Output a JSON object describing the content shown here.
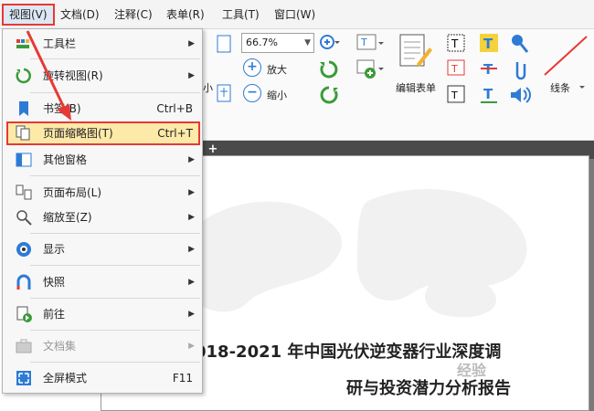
{
  "menubar": {
    "items": [
      {
        "label": "视图(V)",
        "active": true
      },
      {
        "label": "文档(D)"
      },
      {
        "label": "注释(C)"
      },
      {
        "label": "表单(R)"
      },
      {
        "label": "工具(T)"
      },
      {
        "label": "窗口(W)"
      }
    ]
  },
  "view_menu": {
    "items": [
      {
        "label": "工具栏",
        "shortcut": "",
        "submenu": true
      },
      {
        "label": "旋转视图(R)",
        "shortcut": "",
        "submenu": true
      },
      {
        "label": "书签(B)",
        "shortcut": "Ctrl+B",
        "submenu": false
      },
      {
        "label": "页面缩略图(T)",
        "shortcut": "Ctrl+T",
        "submenu": false,
        "highlighted": true
      },
      {
        "label": "其他窗格",
        "shortcut": "",
        "submenu": true
      },
      {
        "label": "页面布局(L)",
        "shortcut": "",
        "submenu": true
      },
      {
        "label": "缩放至(Z)",
        "shortcut": "",
        "submenu": true
      },
      {
        "label": "显示",
        "shortcut": "",
        "submenu": true
      },
      {
        "label": "快照",
        "shortcut": "",
        "submenu": true
      },
      {
        "label": "前往",
        "shortcut": "",
        "submenu": true
      },
      {
        "label": "文档集",
        "shortcut": "",
        "submenu": true,
        "disabled": true
      },
      {
        "label": "全屏模式",
        "shortcut": "F11",
        "submenu": false
      }
    ]
  },
  "toolbar": {
    "zoom_value": "66.7%",
    "zoom_in_label": "放大",
    "zoom_out_label": "缩小",
    "partial_label": "小",
    "edit_form_label": "编辑表单",
    "lines_label": "线条"
  },
  "document": {
    "title_line1": "018-2021 年中国光伏逆变器行业深度调",
    "title_line2": "研与投资潜力分析报告"
  },
  "watermark": "经验",
  "colors": {
    "highlight_border": "#e53935",
    "highlight_fill": "#fde9a8",
    "accent_blue": "#2e7bd6",
    "green": "#3a9b3a"
  }
}
